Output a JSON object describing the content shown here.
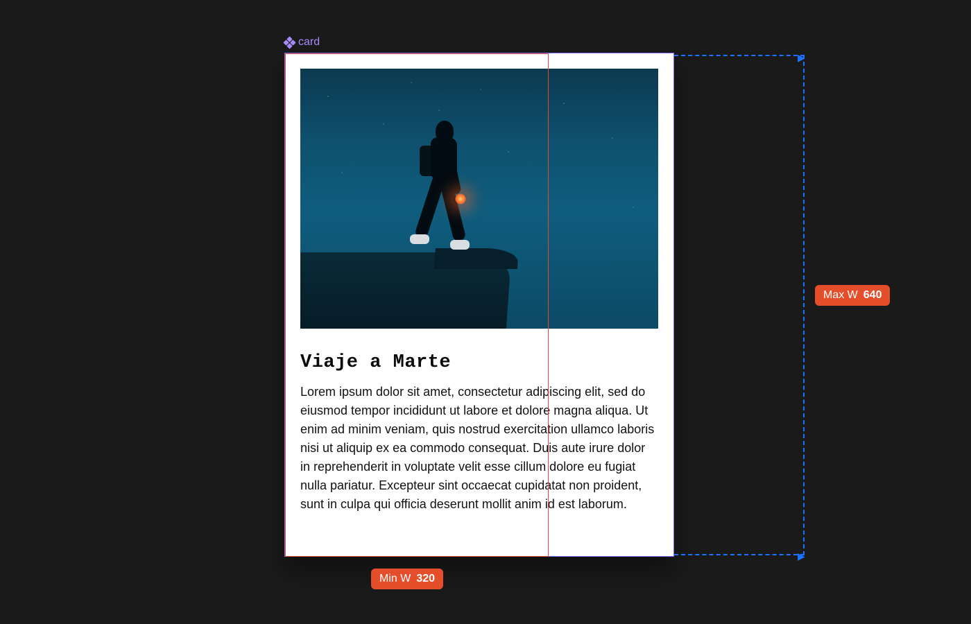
{
  "component": {
    "label": "card"
  },
  "card": {
    "title": "Viaje a Marte",
    "body": "Lorem ipsum dolor sit amet, consectetur adipiscing elit, sed do eiusmod tempor incididunt ut labore et dolore magna aliqua. Ut enim ad minim veniam, quis nostrud exercitation ullamco laboris nisi ut aliquip ex ea commodo consequat. Duis aute irure dolor in reprehenderit in voluptate velit esse cillum dolore eu fugiat nulla pariatur. Excepteur sint occaecat cupidatat non proident, sunt in culpa qui officia deserunt mollit anim id est laborum."
  },
  "constraints": {
    "min_label": "Min W",
    "min_value": "320",
    "max_label": "Max W",
    "max_value": "640"
  }
}
